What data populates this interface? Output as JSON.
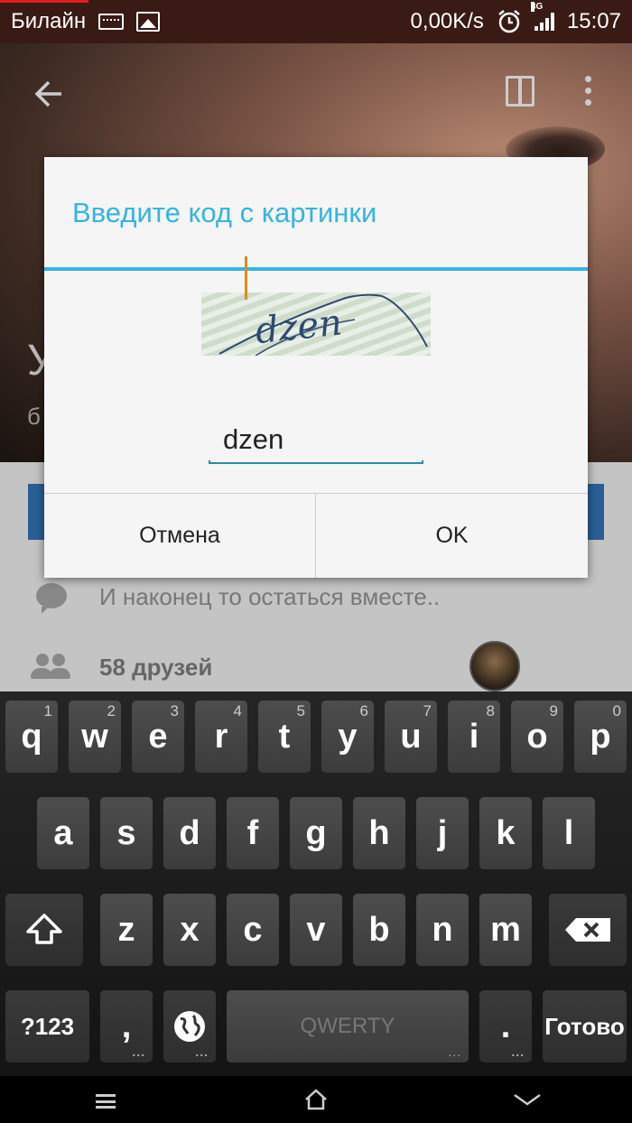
{
  "status_bar": {
    "carrier": "Билайн",
    "network_speed": "0,00K/s",
    "network_type": "3G",
    "time": "15:07",
    "icons": [
      "keyboard-icon",
      "image-icon",
      "alarm-icon",
      "signal-icon",
      "battery-icon"
    ]
  },
  "profile": {
    "name_initial": "У",
    "subtitle_initial": "б",
    "status_text": "И наконец то остаться вместе..",
    "friends_text": "58 друзей"
  },
  "dialog": {
    "title": "Введите код с картинки",
    "captcha_text": "dzen",
    "input_value": "dzen",
    "cancel_label": "Отмена",
    "ok_label": "OK",
    "accent_color": "#33b5e5"
  },
  "keyboard": {
    "row1": [
      {
        "key": "q",
        "hint": "1"
      },
      {
        "key": "w",
        "hint": "2"
      },
      {
        "key": "e",
        "hint": "3"
      },
      {
        "key": "r",
        "hint": "4"
      },
      {
        "key": "t",
        "hint": "5"
      },
      {
        "key": "y",
        "hint": "6"
      },
      {
        "key": "u",
        "hint": "7"
      },
      {
        "key": "i",
        "hint": "8"
      },
      {
        "key": "o",
        "hint": "9"
      },
      {
        "key": "p",
        "hint": "0"
      }
    ],
    "row2": [
      "a",
      "s",
      "d",
      "f",
      "g",
      "h",
      "j",
      "k",
      "l"
    ],
    "row3": [
      "z",
      "x",
      "c",
      "v",
      "b",
      "n",
      "m"
    ],
    "symbols_label": "?123",
    "comma_label": ",",
    "space_label": "QWERTY",
    "period_label": ".",
    "done_label": "Готово"
  }
}
